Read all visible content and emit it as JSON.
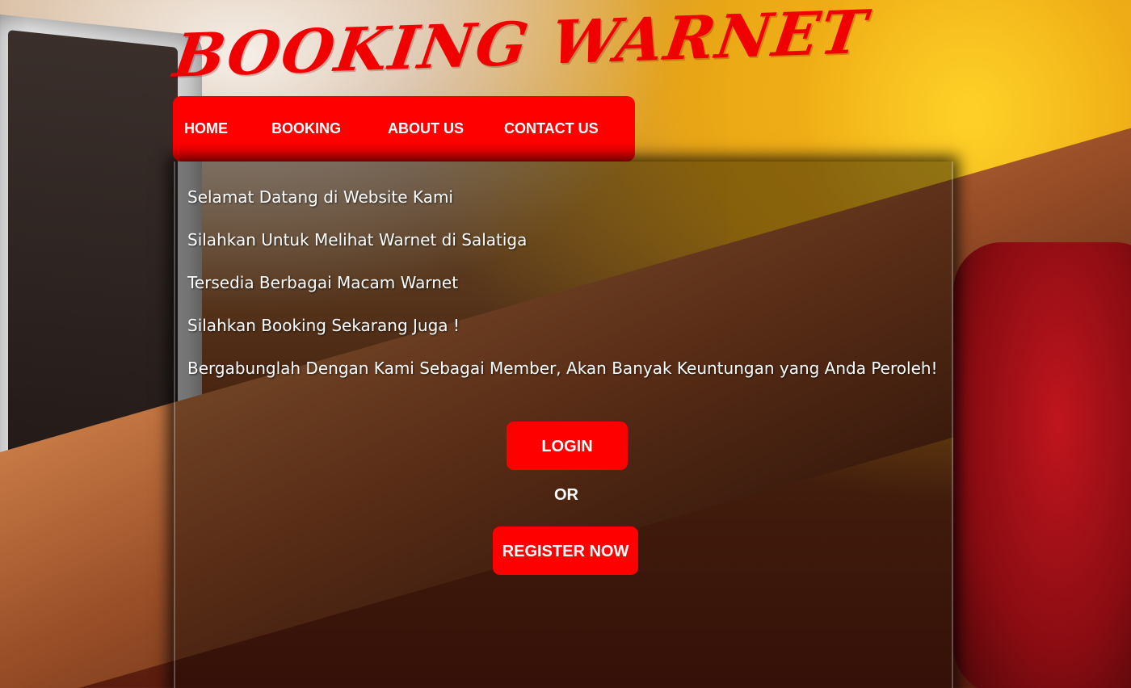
{
  "brand": {
    "title": "BOOKING WARNET",
    "color": "#f00000"
  },
  "nav": {
    "items": [
      {
        "label": "HOME"
      },
      {
        "label": "BOOKING"
      },
      {
        "label": "ABOUT US"
      },
      {
        "label": "CONTACT US"
      }
    ],
    "background": "#ff0000"
  },
  "main": {
    "lines": [
      "Selamat Datang di Website Kami",
      "Silahkan Untuk Melihat Warnet di Salatiga",
      "Tersedia Berbagai Macam Warnet",
      "Silahkan Booking Sekarang Juga !",
      "Bergabunglah Dengan Kami Sebagai Member, Akan Banyak Keuntungan yang Anda Peroleh!"
    ],
    "login_label": "LOGIN",
    "or_label": "OR",
    "register_label": "REGISTER NOW",
    "button_color": "#ff0000"
  }
}
